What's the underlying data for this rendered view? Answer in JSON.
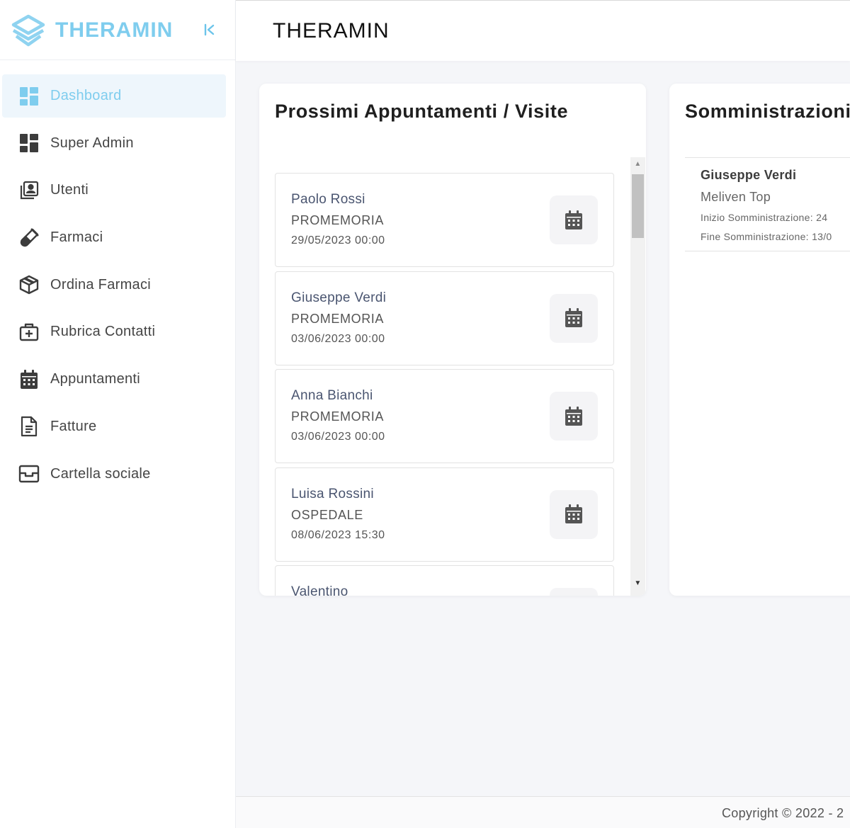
{
  "brand": {
    "name": "THERAMIN",
    "collapse_icon": "collapse-left-icon"
  },
  "sidebar": {
    "items": [
      {
        "label": "Dashboard",
        "icon": "dashboard-icon",
        "active": true
      },
      {
        "label": "Super Admin",
        "icon": "dashboard-icon",
        "active": false
      },
      {
        "label": "Utenti",
        "icon": "contacts-icon",
        "active": false
      },
      {
        "label": "Farmaci",
        "icon": "test-tube-icon",
        "active": false
      },
      {
        "label": "Ordina Farmaci",
        "icon": "package-icon",
        "active": false
      },
      {
        "label": "Rubrica Contatti",
        "icon": "medical-bag-icon",
        "active": false
      },
      {
        "label": "Appuntamenti",
        "icon": "calendar-icon",
        "active": false
      },
      {
        "label": "Fatture",
        "icon": "document-icon",
        "active": false
      },
      {
        "label": "Cartella sociale",
        "icon": "archive-icon",
        "active": false
      }
    ]
  },
  "header": {
    "title": "THERAMIN"
  },
  "appointments": {
    "title": "Prossimi Appuntamenti / Visite",
    "items": [
      {
        "name": "Paolo Rossi",
        "type": "PROMEMORIA",
        "date": "29/05/2023 00:00"
      },
      {
        "name": "Giuseppe Verdi",
        "type": "PROMEMORIA",
        "date": "03/06/2023 00:00"
      },
      {
        "name": "Anna Bianchi",
        "type": "PROMEMORIA",
        "date": "03/06/2023 00:00"
      },
      {
        "name": "Luisa Rossini",
        "type": "OSPEDALE",
        "date": "08/06/2023 15:30"
      },
      {
        "name": "Valentino",
        "type": "",
        "date": ""
      }
    ]
  },
  "administrations": {
    "title": "Somministrazioni",
    "items": [
      {
        "name": "Giuseppe Verdi",
        "drug": "Meliven Top",
        "start": "Inizio Somministrazione: 24",
        "end": "Fine Somministrazione: 13/0"
      }
    ]
  },
  "footer": {
    "copyright": "Copyright © 2022 - 2"
  },
  "colors": {
    "accent": "#7fcdee",
    "active_bg": "#eef6fc"
  }
}
